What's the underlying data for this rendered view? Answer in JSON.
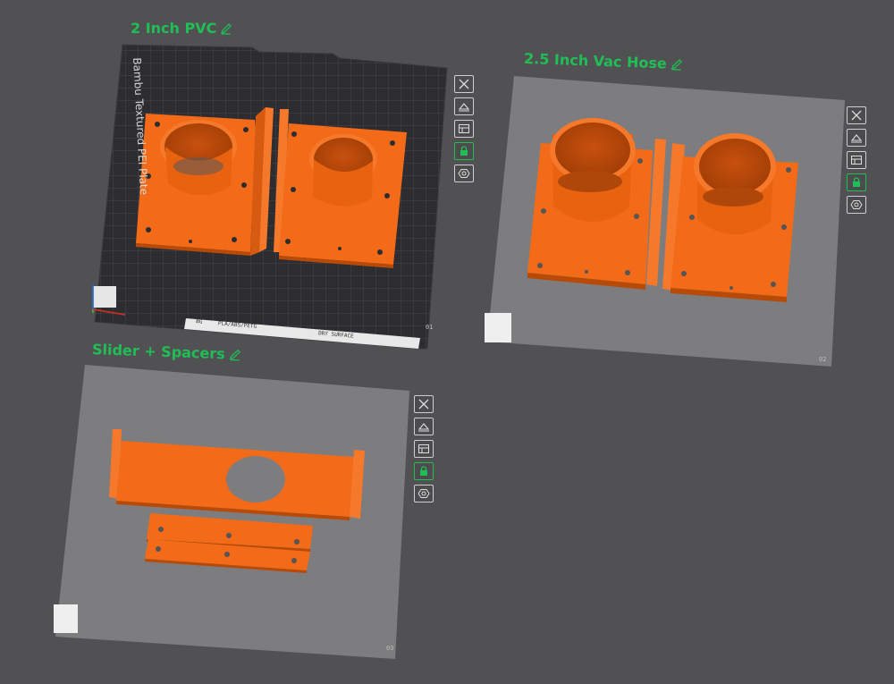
{
  "plates": [
    {
      "label": "2 Inch PVC",
      "number": "01",
      "bed_name": "Bambu Textured PEI Plate",
      "bed_strip_left": "BG",
      "bed_strip_mid": "PLA/ABS/PETG",
      "bed_strip_right": "DRY SURFACE"
    },
    {
      "label": "2.5 Inch Vac Hose",
      "number": "02"
    },
    {
      "label": "Slider + Spacers",
      "number": "03"
    }
  ],
  "toolbar_icons": [
    "close-x-icon",
    "auto-orient-icon",
    "arrange-icon",
    "lock-icon",
    "settings-icon"
  ],
  "colors": {
    "label_green": "#1fbf56",
    "part_orange": "#f36b18",
    "background": "#515154"
  }
}
